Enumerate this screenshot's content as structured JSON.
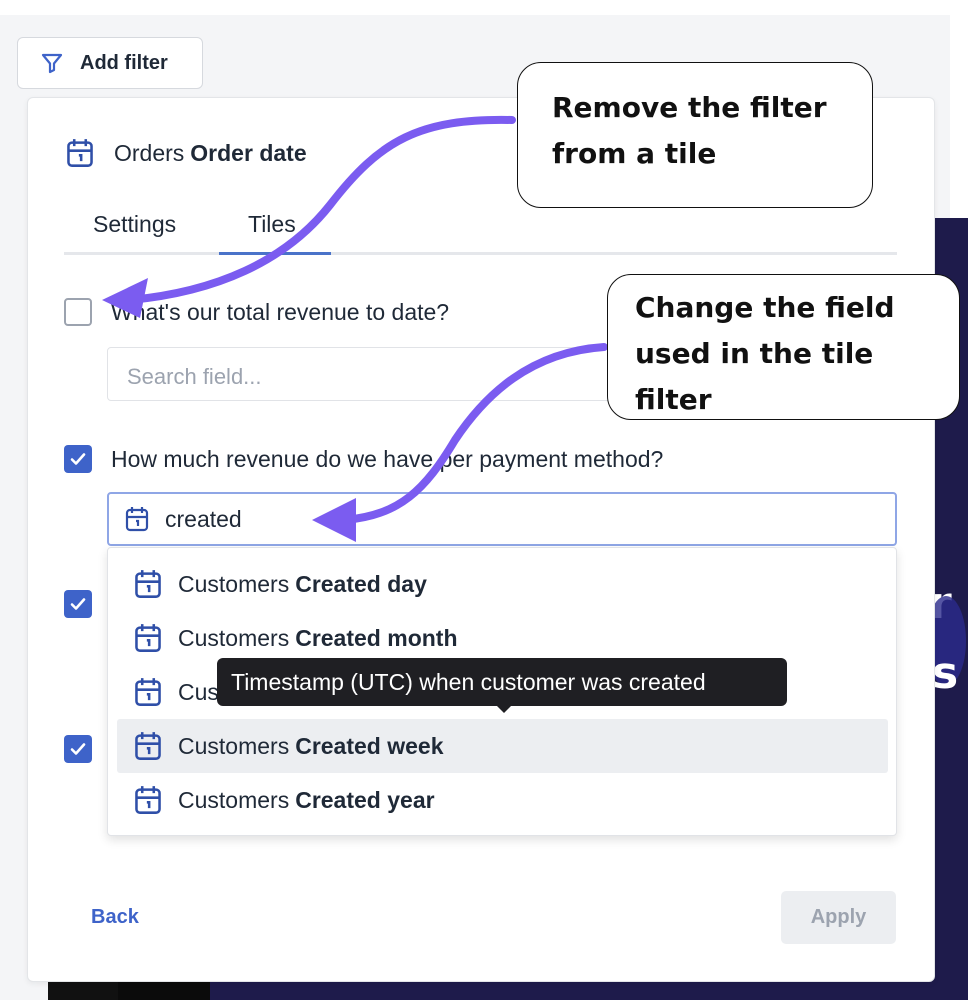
{
  "toolbar": {
    "add_filter_label": "Add filter",
    "filter_icon": "funnel-icon"
  },
  "filter_panel": {
    "title_prefix": "Orders",
    "title_field": "Order date",
    "title_icon": "calendar-icon",
    "tabs": [
      {
        "label": "Settings",
        "active": false
      },
      {
        "label": "Tiles",
        "active": true
      }
    ],
    "tiles": [
      {
        "label": "What's our total revenue to date?",
        "checked": false,
        "field_placeholder": "Search field..."
      },
      {
        "label": "How much revenue do we have per payment method?",
        "checked": true,
        "field_value": "created"
      }
    ],
    "dropdown_options": [
      {
        "prefix": "Customers",
        "field": "Created day"
      },
      {
        "prefix": "Customers",
        "field": "Created month"
      },
      {
        "prefix": "Cus",
        "field": ""
      },
      {
        "prefix": "Customers",
        "field": "Created week",
        "highlighted": true
      },
      {
        "prefix": "Customers",
        "field": "Created year"
      }
    ],
    "tooltip": "Timestamp (UTC) when customer was created",
    "back_label": "Back",
    "apply_label": "Apply"
  },
  "callouts": {
    "remove_filter": [
      "Remove the filter",
      "from a tile"
    ],
    "change_field": [
      "Change the field",
      "used in the tile",
      "filter"
    ]
  },
  "colors": {
    "accent": "#3e63c9",
    "tab_underline": "#4a73c9",
    "arrow": "#7b5cf0",
    "tooltip_bg": "#1f1f23",
    "background_dark": "#1e1b4b"
  }
}
